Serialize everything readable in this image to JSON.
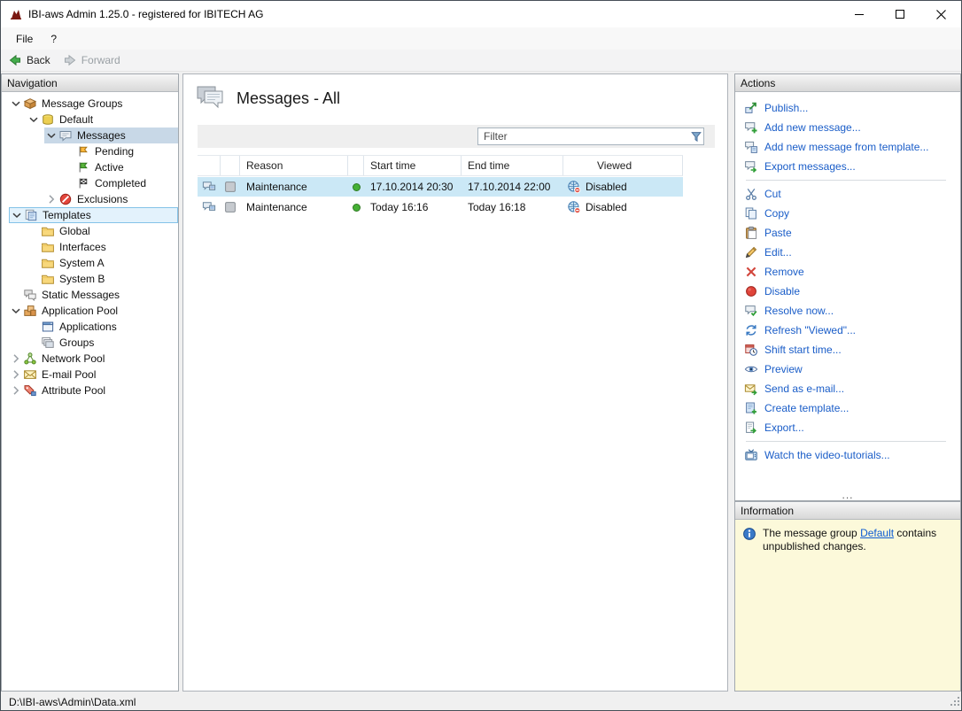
{
  "window": {
    "title": "IBI-aws Admin 1.25.0 - registered for IBITECH AG",
    "menu": [
      "File",
      "?"
    ],
    "status_path": "D:\\IBI-aws\\Admin\\Data.xml"
  },
  "toolbar": {
    "back": "Back",
    "forward": "Forward"
  },
  "navigation": {
    "header": "Navigation",
    "tree": [
      {
        "label": "Message Groups",
        "depth": 0,
        "expand": "expanded",
        "icon": "message-groups",
        "state": "normal"
      },
      {
        "label": "Default",
        "depth": 1,
        "expand": "expanded",
        "icon": "default-group",
        "state": "normal"
      },
      {
        "label": "Messages",
        "depth": 2,
        "expand": "expanded",
        "icon": "messages",
        "state": "selected"
      },
      {
        "label": "Pending",
        "depth": 3,
        "expand": "none",
        "icon": "flag-pending",
        "state": "normal"
      },
      {
        "label": "Active",
        "depth": 3,
        "expand": "none",
        "icon": "flag-active",
        "state": "normal"
      },
      {
        "label": "Completed",
        "depth": 3,
        "expand": "none",
        "icon": "flag-completed",
        "state": "normal"
      },
      {
        "label": "Exclusions",
        "depth": 2,
        "expand": "collapsed",
        "icon": "exclusions",
        "state": "normal"
      },
      {
        "label": "Templates",
        "depth": 0,
        "expand": "expanded",
        "icon": "templates",
        "state": "highlighted"
      },
      {
        "label": "Global",
        "depth": 1,
        "expand": "none",
        "icon": "folder",
        "state": "normal"
      },
      {
        "label": "Interfaces",
        "depth": 1,
        "expand": "none",
        "icon": "folder",
        "state": "normal"
      },
      {
        "label": "System A",
        "depth": 1,
        "expand": "none",
        "icon": "folder",
        "state": "normal"
      },
      {
        "label": "System B",
        "depth": 1,
        "expand": "none",
        "icon": "folder",
        "state": "normal"
      },
      {
        "label": "Static Messages",
        "depth": 0,
        "expand": "none",
        "icon": "static-messages",
        "state": "normal"
      },
      {
        "label": "Application Pool",
        "depth": 0,
        "expand": "expanded",
        "icon": "application-pool",
        "state": "normal"
      },
      {
        "label": "Applications",
        "depth": 1,
        "expand": "none",
        "icon": "applications",
        "state": "normal"
      },
      {
        "label": "Groups",
        "depth": 1,
        "expand": "none",
        "icon": "groups",
        "state": "normal"
      },
      {
        "label": "Network Pool",
        "depth": 0,
        "expand": "collapsed",
        "icon": "network-pool",
        "state": "normal"
      },
      {
        "label": "E-mail Pool",
        "depth": 0,
        "expand": "collapsed",
        "icon": "email-pool",
        "state": "normal"
      },
      {
        "label": "Attribute Pool",
        "depth": 0,
        "expand": "collapsed",
        "icon": "attribute-pool",
        "state": "normal"
      }
    ]
  },
  "main": {
    "title": "Messages - All",
    "filter_placeholder": "Filter",
    "table": {
      "columns": [
        "Reason",
        "Start time",
        "End time",
        "Viewed"
      ],
      "rows": [
        {
          "reason": "Maintenance",
          "status_color": "#45b035",
          "start_time": "17.10.2014 20:30",
          "end_time": "17.10.2014 22:00",
          "viewed": "Disabled",
          "selected": true
        },
        {
          "reason": "Maintenance",
          "status_color": "#45b035",
          "start_time": "Today 16:16",
          "end_time": "Today 16:18",
          "viewed": "Disabled",
          "selected": false
        }
      ]
    }
  },
  "actions": {
    "header": "Actions",
    "overflow": "...",
    "groups": [
      {
        "items": [
          {
            "label": "Publish...",
            "icon": "publish"
          },
          {
            "label": "Add new message...",
            "icon": "add-message"
          },
          {
            "label": "Add new message from template...",
            "icon": "add-message-template"
          },
          {
            "label": "Export messages...",
            "icon": "export-messages"
          }
        ]
      },
      {
        "items": [
          {
            "label": "Cut",
            "icon": "cut"
          },
          {
            "label": "Copy",
            "icon": "copy"
          },
          {
            "label": "Paste",
            "icon": "paste"
          },
          {
            "label": "Edit...",
            "icon": "edit"
          },
          {
            "label": "Remove",
            "icon": "remove"
          },
          {
            "label": "Disable",
            "icon": "disable"
          },
          {
            "label": "Resolve now...",
            "icon": "resolve-now"
          },
          {
            "label": "Refresh \"Viewed\"...",
            "icon": "refresh-viewed"
          },
          {
            "label": "Shift start time...",
            "icon": "shift-start-time"
          },
          {
            "label": "Preview",
            "icon": "preview"
          },
          {
            "label": "Send as e-mail...",
            "icon": "send-email"
          },
          {
            "label": "Create template...",
            "icon": "create-template"
          },
          {
            "label": "Export...",
            "icon": "export"
          }
        ]
      },
      {
        "items": [
          {
            "label": "Watch the video-tutorials...",
            "icon": "video-tutorials"
          }
        ]
      }
    ]
  },
  "information": {
    "header": "Information",
    "text_before": "The message group ",
    "link_text": "Default",
    "text_after": " contains unpublished changes."
  }
}
